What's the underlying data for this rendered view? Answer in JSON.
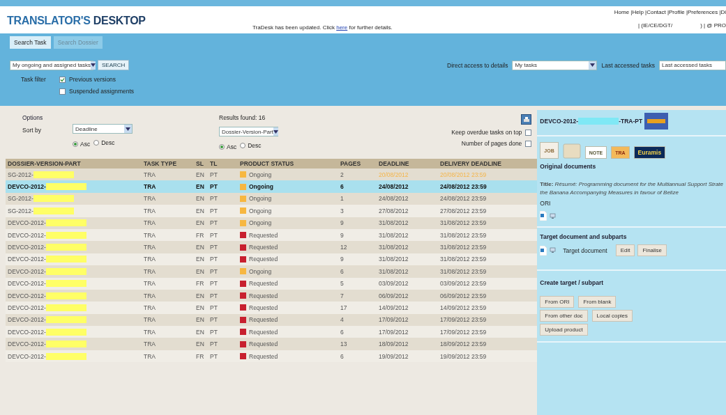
{
  "header": {
    "logo_light": "TRANSLATOR'S",
    "logo_bold": "DESKTOP",
    "notice_before": "TraDesk has been updated. Click ",
    "notice_link": "here",
    "notice_after": " for further details.",
    "links": "Home |Help |Contact |Profile |Preferences |Di",
    "user_left": "| (IE/CE/DGT/",
    "user_right": ") | @ PRO"
  },
  "tabs": [
    {
      "label": "Search Task",
      "selected": true
    },
    {
      "label": "Search Dossier",
      "selected": false
    }
  ],
  "search": {
    "task_select": "My ongoing and assigned tasks",
    "search_button": "SEARCH",
    "filter_label": "Task filter",
    "filters": [
      {
        "label": "Previous versions",
        "checked": true
      },
      {
        "label": "Suspended assignments",
        "checked": false
      }
    ],
    "direct_label": "Direct access to details",
    "direct_value": "My tasks",
    "last_label": "Last accessed tasks",
    "last_value": "Last accessed tasks"
  },
  "options": {
    "title": "Options",
    "sort_label": "Sort by",
    "sort_value": "Deadline",
    "sort_order": [
      {
        "label": "Asc",
        "selected": true
      },
      {
        "label": "Desc",
        "selected": false
      }
    ],
    "results": "Results found: 16",
    "sort2_value": "Dossier-Version-Part",
    "sort2_order": [
      {
        "label": "Asc",
        "selected": true
      },
      {
        "label": "Desc",
        "selected": false
      }
    ],
    "checks": [
      {
        "label": "Keep overdue tasks on top",
        "checked": false
      },
      {
        "label": "Number of pages done",
        "checked": false
      }
    ]
  },
  "table": {
    "columns": [
      "DOSSIER-VERSION-PART",
      "TASK TYPE",
      "SL",
      "TL",
      "PRODUCT STATUS",
      "PAGES",
      "DEADLINE",
      "DELIVERY DEADLINE"
    ],
    "rows": [
      {
        "dossier": "SG-2012-",
        "task_type": "TRA",
        "sl": "EN",
        "tl": "PT",
        "status": "Ongoing",
        "kind": "ongoing",
        "pages": "2",
        "deadline": "20/08/2012",
        "delivery": "20/08/2012 23:59",
        "overdue": true,
        "selected": false
      },
      {
        "dossier": "DEVCO-2012-",
        "task_type": "TRA",
        "sl": "EN",
        "tl": "PT",
        "status": "Ongoing",
        "kind": "ongoing",
        "pages": "6",
        "deadline": "24/08/2012",
        "delivery": "24/08/2012 23:59",
        "overdue": false,
        "selected": true
      },
      {
        "dossier": "SG-2012-",
        "task_type": "TRA",
        "sl": "EN",
        "tl": "PT",
        "status": "Ongoing",
        "kind": "ongoing",
        "pages": "1",
        "deadline": "24/08/2012",
        "delivery": "24/08/2012 23:59",
        "overdue": false,
        "selected": false
      },
      {
        "dossier": "SG-2012-",
        "task_type": "TRA",
        "sl": "EN",
        "tl": "PT",
        "status": "Ongoing",
        "kind": "ongoing",
        "pages": "3",
        "deadline": "27/08/2012",
        "delivery": "27/08/2012 23:59",
        "overdue": false,
        "selected": false
      },
      {
        "dossier": "DEVCO-2012-",
        "task_type": "TRA",
        "sl": "EN",
        "tl": "PT",
        "status": "Ongoing",
        "kind": "ongoing",
        "pages": "9",
        "deadline": "31/08/2012",
        "delivery": "31/08/2012 23:59",
        "overdue": false,
        "selected": false
      },
      {
        "dossier": "DEVCO-2012-",
        "task_type": "TRA",
        "sl": "FR",
        "tl": "PT",
        "status": "Requested",
        "kind": "requested",
        "pages": "9",
        "deadline": "31/08/2012",
        "delivery": "31/08/2012 23:59",
        "overdue": false,
        "selected": false
      },
      {
        "dossier": "DEVCO-2012-",
        "task_type": "TRA",
        "sl": "EN",
        "tl": "PT",
        "status": "Requested",
        "kind": "requested",
        "pages": "12",
        "deadline": "31/08/2012",
        "delivery": "31/08/2012 23:59",
        "overdue": false,
        "selected": false
      },
      {
        "dossier": "DEVCO-2012-",
        "task_type": "TRA",
        "sl": "EN",
        "tl": "PT",
        "status": "Requested",
        "kind": "requested",
        "pages": "9",
        "deadline": "31/08/2012",
        "delivery": "31/08/2012 23:59",
        "overdue": false,
        "selected": false
      },
      {
        "dossier": "DEVCO-2012-",
        "task_type": "TRA",
        "sl": "EN",
        "tl": "PT",
        "status": "Ongoing",
        "kind": "ongoing",
        "pages": "6",
        "deadline": "31/08/2012",
        "delivery": "31/08/2012 23:59",
        "overdue": false,
        "selected": false
      },
      {
        "dossier": "DEVCO-2012-",
        "task_type": "TRA",
        "sl": "FR",
        "tl": "PT",
        "status": "Requested",
        "kind": "requested",
        "pages": "5",
        "deadline": "03/09/2012",
        "delivery": "03/09/2012 23:59",
        "overdue": false,
        "selected": false
      },
      {
        "dossier": "DEVCO-2012-",
        "task_type": "TRA",
        "sl": "EN",
        "tl": "PT",
        "status": "Requested",
        "kind": "requested",
        "pages": "7",
        "deadline": "06/09/2012",
        "delivery": "06/09/2012 23:59",
        "overdue": false,
        "selected": false
      },
      {
        "dossier": "DEVCO-2012-",
        "task_type": "TRA",
        "sl": "EN",
        "tl": "PT",
        "status": "Requested",
        "kind": "requested",
        "pages": "17",
        "deadline": "14/09/2012",
        "delivery": "14/09/2012 23:59",
        "overdue": false,
        "selected": false
      },
      {
        "dossier": "DEVCO-2012-",
        "task_type": "TRA",
        "sl": "EN",
        "tl": "PT",
        "status": "Requested",
        "kind": "requested",
        "pages": "4",
        "deadline": "17/09/2012",
        "delivery": "17/09/2012 23:59",
        "overdue": false,
        "selected": false
      },
      {
        "dossier": "DEVCO-2012-",
        "task_type": "TRA",
        "sl": "EN",
        "tl": "PT",
        "status": "Requested",
        "kind": "requested",
        "pages": "6",
        "deadline": "17/09/2012",
        "delivery": "17/09/2012 23:59",
        "overdue": false,
        "selected": false
      },
      {
        "dossier": "DEVCO-2012-",
        "task_type": "TRA",
        "sl": "EN",
        "tl": "PT",
        "status": "Requested",
        "kind": "requested",
        "pages": "13",
        "deadline": "18/09/2012",
        "delivery": "18/09/2012 23:59",
        "overdue": false,
        "selected": false
      },
      {
        "dossier": "DEVCO-2012-",
        "task_type": "TRA",
        "sl": "FR",
        "tl": "PT",
        "status": "Requested",
        "kind": "requested",
        "pages": "6",
        "deadline": "19/09/2012",
        "delivery": "19/09/2012 23:59",
        "overdue": false,
        "selected": false
      }
    ]
  },
  "detail": {
    "id_before": "DEVCO-2012-",
    "id_after": "-TRA-PT",
    "toolbar": [
      "JOB",
      "NOTE",
      "TRA",
      "Euramis"
    ],
    "original_heading": "Original documents",
    "title_line1": "**Title:**  *Résumé: Programming document for the Multiannual Support Strate*",
    "title_line2": "*the Banana Accompanying Measures in favour of Belize*",
    "ori_label": "ORI",
    "target_heading": "Target document and subparts",
    "target_doc": "Target document",
    "target_buttons": [
      "Edit",
      "Finalise"
    ],
    "create_heading": "Create target / subpart",
    "create_buttons": [
      "From ORI",
      "From blank",
      "From other doc",
      "Local copies",
      "Upload product"
    ]
  }
}
